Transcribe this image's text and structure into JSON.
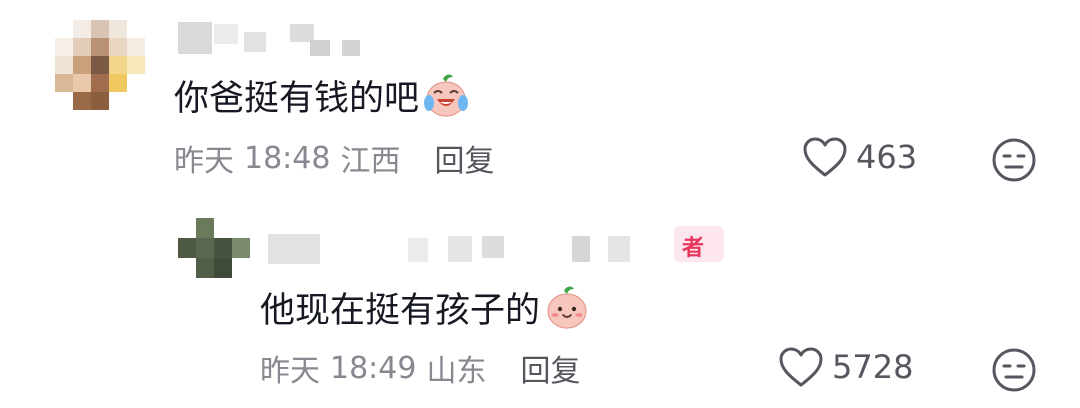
{
  "comments": [
    {
      "text": "你爸挺有钱的吧",
      "emoji": "laughing-crying-emoji",
      "time_prefix": "昨天",
      "time": "18:48",
      "location": "江西",
      "reply_label": "回复",
      "likes": "463"
    }
  ],
  "reply": {
    "text": "他现在挺有孩子的",
    "emoji": "smiling-peach-emoji",
    "badge": "者",
    "time_prefix": "昨天",
    "time": "18:49",
    "location": "山东",
    "reply_label": "回复",
    "likes": "5728"
  },
  "colors": {
    "primary_text": "#161823",
    "meta_text": "#878890",
    "action_text": "#55565e",
    "badge_pink": "#e8375a"
  }
}
